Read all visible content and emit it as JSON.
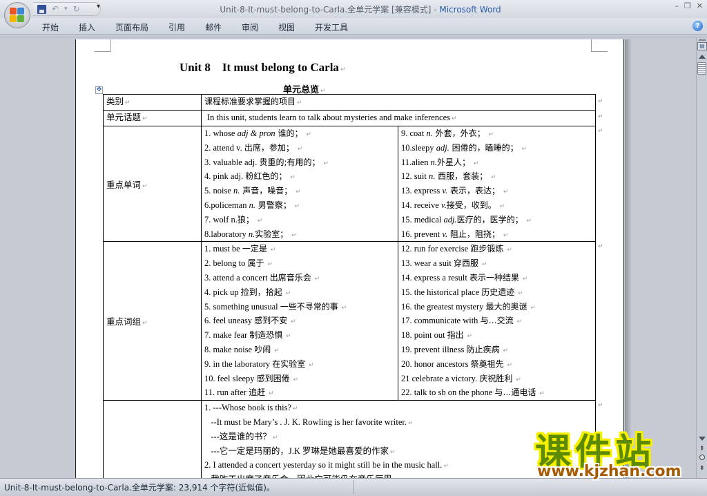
{
  "window": {
    "title_doc": "Unit-8-It-must-belong-to-Carla.全单元学案 [兼容模式]",
    "title_sep": " - ",
    "title_app": "Microsoft Word",
    "controls": {
      "minimize": "–",
      "restore": "❐",
      "close": "✕"
    }
  },
  "quick_access": {
    "save": "save-icon",
    "undo": "↶",
    "undo_dropdown": "▾",
    "redo": "↻",
    "customize": "▾"
  },
  "ribbon": {
    "tabs": [
      "开始",
      "插入",
      "页面布局",
      "引用",
      "邮件",
      "审阅",
      "视图",
      "开发工具"
    ],
    "help": "?"
  },
  "document": {
    "title": "Unit 8    It must belong to Carla",
    "section_title": "单元总览",
    "paragraph_mark": "↵",
    "table": {
      "header": {
        "col1": "类别",
        "col2": "课程标准要求掌握的项目"
      },
      "topic": {
        "label": "单元话题",
        "text": "In this unit, students learn to talk about mysteries and make inferences"
      },
      "vocab": {
        "label": "重点单词",
        "left": [
          {
            "en": "1. whose    ",
            "pos": "adj & pron",
            "zh": " 谁的；"
          },
          {
            "en": "2. attend v. ",
            "pos": "",
            "zh": "出席，参加；"
          },
          {
            "en": "3. valuable adj. ",
            "pos": "",
            "zh": "贵重的;有用的；"
          },
          {
            "en": "4. pink adj. ",
            "pos": "",
            "zh": "粉红色的；"
          },
          {
            "en": "5. noise ",
            "pos": "n.",
            "zh": " 声音，噪音；"
          },
          {
            "en": "6.policeman ",
            "pos": "n.",
            "zh": " 男警察；"
          },
          {
            "en": "7. wolf n.",
            "pos": "",
            "zh": "狼；"
          },
          {
            "en": "8.laboratory ",
            "pos": "n.",
            "zh": "实验室；"
          }
        ],
        "right": [
          {
            "en": "9. coat ",
            "pos": "n.",
            "zh": " 外套，外衣；"
          },
          {
            "en": "10.sleepy ",
            "pos": "adj.",
            "zh": " 困倦的，瞌睡的；"
          },
          {
            "en": "11.alien ",
            "pos": "n.",
            "zh": "外星人；"
          },
          {
            "en": "12. suit ",
            "pos": "n.",
            "zh": " 西服，套装；"
          },
          {
            "en": "13. express ",
            "pos": "v.",
            "zh": " 表示，表达；"
          },
          {
            "en": "14. receive ",
            "pos": "v.",
            "zh": "接受，收到。"
          },
          {
            "en": "15. medical ",
            "pos": "adj.",
            "zh": "医疗的，医学的；"
          },
          {
            "en": "16. prevent ",
            "pos": "v.",
            "zh": " 阻止，阻挠；"
          }
        ]
      },
      "phrases": {
        "label": "重点词组",
        "left": [
          {
            "en": "1. must be ",
            "zh": "一定是"
          },
          {
            "en": "2. belong to    ",
            "zh": "属于"
          },
          {
            "en": "3. attend a concert ",
            "zh": "出席音乐会"
          },
          {
            "en": "4. pick up ",
            "zh": "捡到，拾起"
          },
          {
            "en": "5. something unusual ",
            "zh": "一些不寻常的事"
          },
          {
            "en": "6. feel uneasy ",
            "zh": "感到不安"
          },
          {
            "en": "7. make fear ",
            "zh": "制造恐惧"
          },
          {
            "en": "8. make noise ",
            "zh": "吵闹"
          },
          {
            "en": "9. in the laboratory ",
            "zh": "在实验室"
          },
          {
            "en": "10. feel sleepy ",
            "zh": "感到困倦"
          },
          {
            "en": "11. run after ",
            "zh": "追赶"
          }
        ],
        "right": [
          {
            "en": "12. run for exercise ",
            "zh": "跑步锻炼"
          },
          {
            "en": "13. wear a suit ",
            "zh": "穿西服"
          },
          {
            "en": "14. express a result ",
            "zh": "表示一种结果"
          },
          {
            "en": "15. the historical place ",
            "zh": "历史遗迹"
          },
          {
            "en": "16. the greatest mystery ",
            "zh": "最大的奥谜"
          },
          {
            "en": "17. communicate with ",
            "zh": "与…交流"
          },
          {
            "en": "18. point out ",
            "zh": "指出"
          },
          {
            "en": "19. prevent illness ",
            "zh": "防止疾病"
          },
          {
            "en": "20. honor ancestors ",
            "zh": "祭奠祖先"
          },
          {
            "en": "21 celebrate a victory. ",
            "zh": "庆祝胜利"
          },
          {
            "en": "22. talk to sb on the phone ",
            "zh": "与…通电话"
          }
        ]
      },
      "sentences": {
        "label": "",
        "lines": [
          "1. ---Whose book is this?",
          "   --It must be Mary’s . J. K. Rowling is her favorite writer.",
          "   ---这是谁的书？",
          "   ---它一定是玛丽的，J.K 罗琳是她最喜爱的作家",
          "2. I attended a concert yesterday so it might still be in the music hall.",
          "   我昨天出席了音乐会，因此它可能仍在音乐厅里。"
        ]
      }
    }
  },
  "status_bar": {
    "text": "Unit-8-It-must-belong-to-Carla.全单元学案: 23,914 个字符(近似值)。"
  },
  "watermark": {
    "cn": "课件站",
    "url": "www.kjzhan.com"
  }
}
